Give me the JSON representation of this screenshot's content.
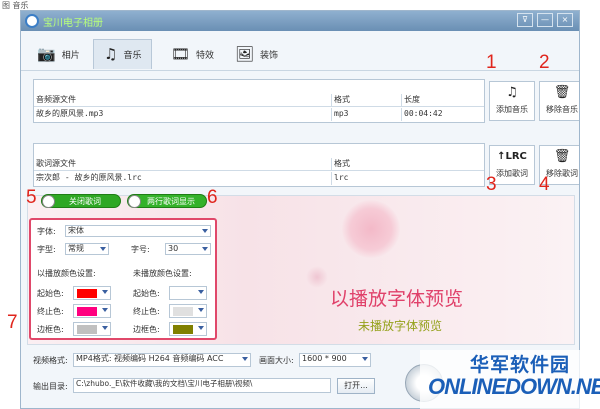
{
  "page_caption": "图 音乐",
  "window": {
    "title": "宝川电子相册",
    "controls": [
      "⊽",
      "—",
      "×"
    ]
  },
  "tabs": [
    {
      "label": "相片",
      "icon": "camera-icon",
      "glyph": "📷",
      "active": false
    },
    {
      "label": "音乐",
      "icon": "music-note-icon",
      "glyph": "♫",
      "active": true
    },
    {
      "label": "特效",
      "icon": "effects-icon",
      "glyph": "🎞",
      "active": false
    },
    {
      "label": "装饰",
      "icon": "image-icon",
      "glyph": "🖼",
      "active": false
    }
  ],
  "music_table": {
    "headers": [
      "音频源文件",
      "格式",
      "长度"
    ],
    "rows": [
      [
        "故乡的原风景.mp3",
        "mp3",
        "00:04:42"
      ]
    ]
  },
  "lyrics_table": {
    "headers": [
      "歌词源文件",
      "格式"
    ],
    "rows": [
      [
        "宗次郎 - 故乡的原风景.lrc",
        "lrc"
      ]
    ]
  },
  "tools": {
    "add_music": {
      "label": "添加音乐",
      "glyph": "♫",
      "icon": "add-music-icon"
    },
    "remove_music": {
      "label": "移除音乐",
      "glyph": "🗑",
      "icon": "trash-icon"
    },
    "add_lyrics": {
      "label": "添加歌词",
      "glyph": "↑LRC",
      "icon": "add-lrc-icon"
    },
    "remove_lyrics": {
      "label": "移除歌词",
      "glyph": "🗑",
      "icon": "trash-icon"
    }
  },
  "callouts": {
    "n1": "1",
    "n2": "2",
    "n3": "3",
    "n4": "4",
    "n5": "5",
    "n6": "6",
    "n7": "7"
  },
  "toggles": {
    "close_lyrics": "关闭歌词",
    "two_line_lyrics": "两行歌词显示"
  },
  "font_settings": {
    "font_label": "字体:",
    "font_value": "宋体",
    "style_label": "字型:",
    "style_value": "常规",
    "size_label": "字号:",
    "size_value": "30",
    "played_title": "以播放颜色设置:",
    "unplayed_title": "未播放颜色设置:",
    "start_label": "起始色:",
    "end_label": "终止色:",
    "border_label": "边框色:",
    "colors": {
      "played_start": "#ff0000",
      "played_end": "#ff0080",
      "played_border": "#c0c0c0",
      "unplayed_start": "#ffffff",
      "unplayed_end": "#e0e0e0",
      "unplayed_border": "#808000"
    }
  },
  "preview": {
    "played_text": "以播放字体预览",
    "unplayed_text": "未播放字体预览"
  },
  "output": {
    "format_label": "视频格式:",
    "format_value": "MP4格式: 视频编码 H264 音频编码 ACC",
    "size_label": "画面大小:",
    "size_value": "1600 * 900",
    "dir_label": "输出目录:",
    "dir_value": "C:\\zhubo._E\\软件收藏\\我的文档\\宝川电子相册\\视频\\",
    "open_button": "打开..."
  },
  "watermark": {
    "top": "华军软件园",
    "bottom": "ONLINEDOWN.NET"
  }
}
